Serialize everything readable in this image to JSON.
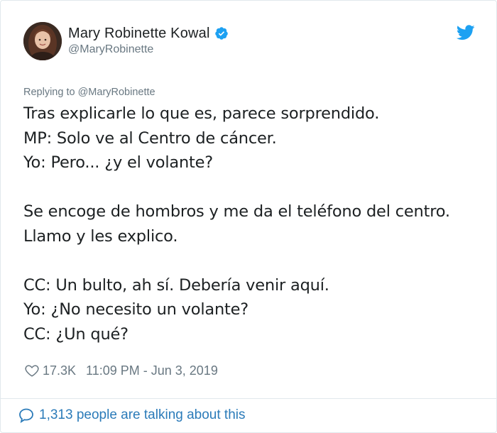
{
  "author": {
    "display_name": "Mary Robinette Kowal",
    "handle": "@MaryRobinette",
    "verified": true,
    "avatar_icon": "user-avatar-photo"
  },
  "platform_icon": "twitter-bird-icon",
  "reply": {
    "prefix": "Replying to",
    "to_handle": "@MaryRobinette"
  },
  "tweet": {
    "lines": [
      "Tras explicarle lo que es, parece sorprendido.",
      "MP: Solo ve al Centro de cáncer.",
      "Yo: Pero... ¿y el volante?",
      "",
      "Se encoge de hombros y me da el teléfono del centro.",
      "Llamo y les explico.",
      "",
      "CC: Un bulto, ah sí. Debería venir aquí.",
      "Yo: ¿No necesito un volante?",
      "CC: ¿Un qué?"
    ]
  },
  "meta": {
    "likes": "17.3K",
    "timestamp": "11:09 PM - Jun 3, 2019"
  },
  "footer": {
    "talking_text": "1,313 people are talking about this"
  },
  "colors": {
    "text": "#1c2022",
    "secondary": "#697882",
    "link": "#2b7bb9",
    "verified": "#1da1f2",
    "border": "#e1e8ed"
  }
}
